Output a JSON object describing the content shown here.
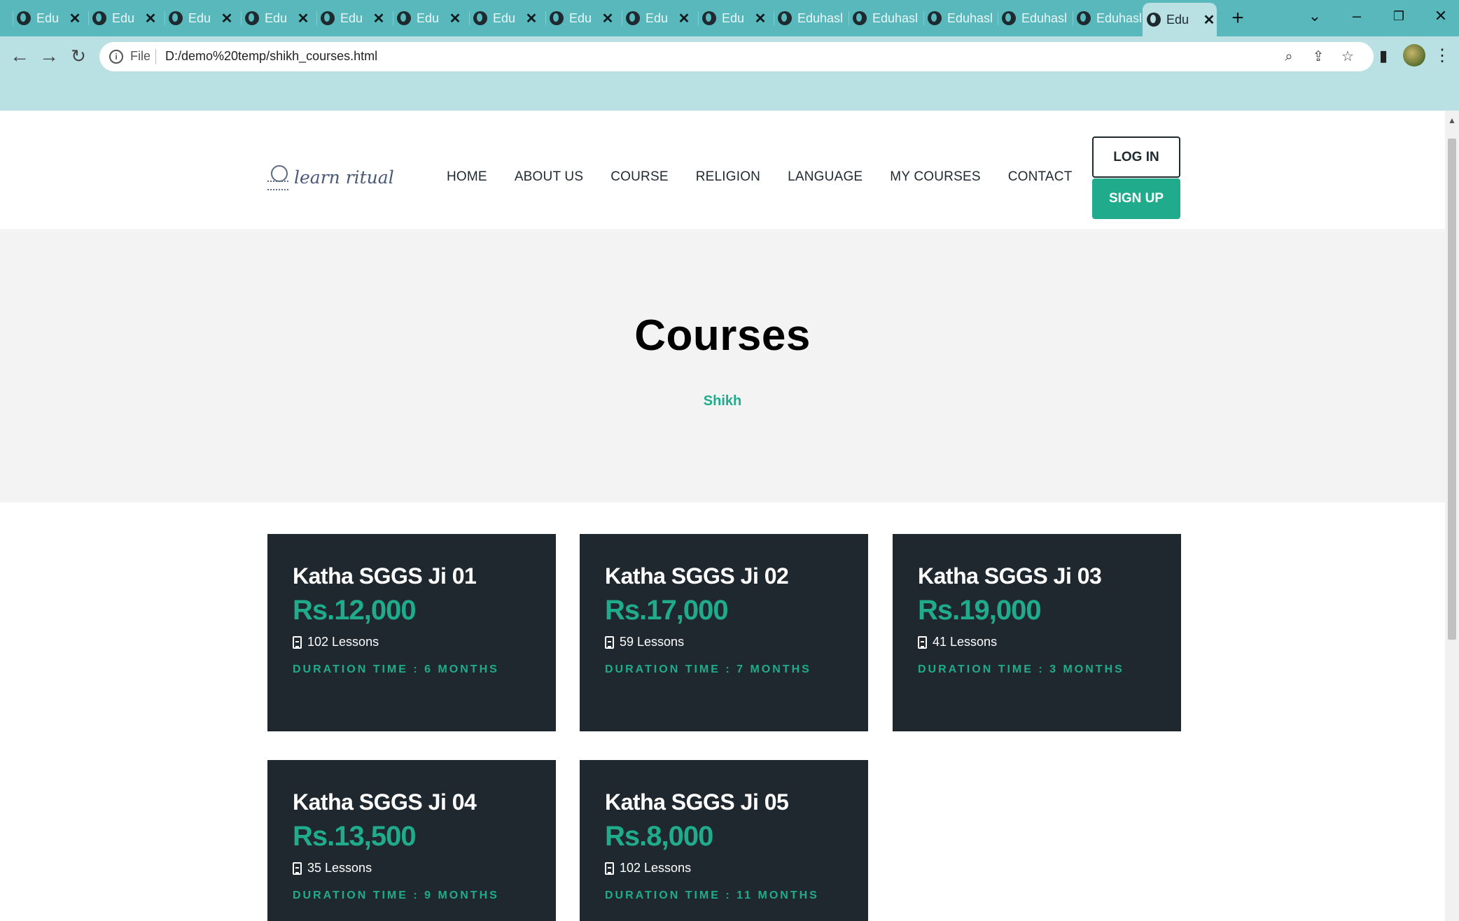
{
  "browser": {
    "tabs": [
      {
        "title": "Edu"
      },
      {
        "title": "Edu"
      },
      {
        "title": "Edu"
      },
      {
        "title": "Edu"
      },
      {
        "title": "Edu"
      },
      {
        "title": "Edu"
      },
      {
        "title": "Edu"
      },
      {
        "title": "Edu"
      },
      {
        "title": "Edu"
      },
      {
        "title": "Edu"
      },
      {
        "title": "Eduhasl"
      },
      {
        "title": "Eduhasl"
      },
      {
        "title": "Eduhasl"
      },
      {
        "title": "Eduhasl"
      },
      {
        "title": "Eduhasl"
      },
      {
        "title": "Edu"
      }
    ],
    "address_prefix": "File",
    "url": "D:/demo%20temp/shikh_courses.html",
    "icons": [
      "globe-icon",
      "close-icon",
      "plus-icon",
      "chevron-down-icon",
      "minimize-icon",
      "restore-icon",
      "close-window-icon",
      "back-icon",
      "forward-icon",
      "reload-icon",
      "info-icon",
      "zoom-icon",
      "share-icon",
      "star-icon",
      "sidepanel-icon",
      "avatar",
      "kebab-menu-icon"
    ]
  },
  "site": {
    "logo_text": "learn ritual",
    "nav": [
      "HOME",
      "ABOUT US",
      "COURSE",
      "RELIGION",
      "LANGUAGE",
      "MY COURSES",
      "CONTACT"
    ],
    "login_label": "LOG IN",
    "signup_label": "SIGN UP",
    "hero_title": "Courses",
    "hero_subtitle": "Shikh",
    "colors": {
      "accent": "#20ac8c",
      "card_bg": "#1f282f",
      "hero_bg": "#f3f3f3",
      "tabstrip": "#58b8bb",
      "toolbar": "#b9e1e4"
    }
  },
  "courses": [
    {
      "name": "Katha SGGS Ji 01",
      "price": "Rs.12,000",
      "lessons": "102 Lessons",
      "duration": "DURATION TIME : 6 MONTHS"
    },
    {
      "name": "Katha SGGS Ji 02",
      "price": "Rs.17,000",
      "lessons": "59 Lessons",
      "duration": "DURATION TIME : 7 MONTHS"
    },
    {
      "name": "Katha SGGS Ji 03",
      "price": "Rs.19,000",
      "lessons": "41 Lessons",
      "duration": "DURATION TIME : 3 MONTHS"
    },
    {
      "name": "Katha SGGS Ji 04",
      "price": "Rs.13,500",
      "lessons": "35 Lessons",
      "duration": "DURATION TIME : 9 MONTHS"
    },
    {
      "name": "Katha SGGS Ji 05",
      "price": "Rs.8,000",
      "lessons": "102 Lessons",
      "duration": "DURATION TIME : 11 MONTHS"
    }
  ]
}
